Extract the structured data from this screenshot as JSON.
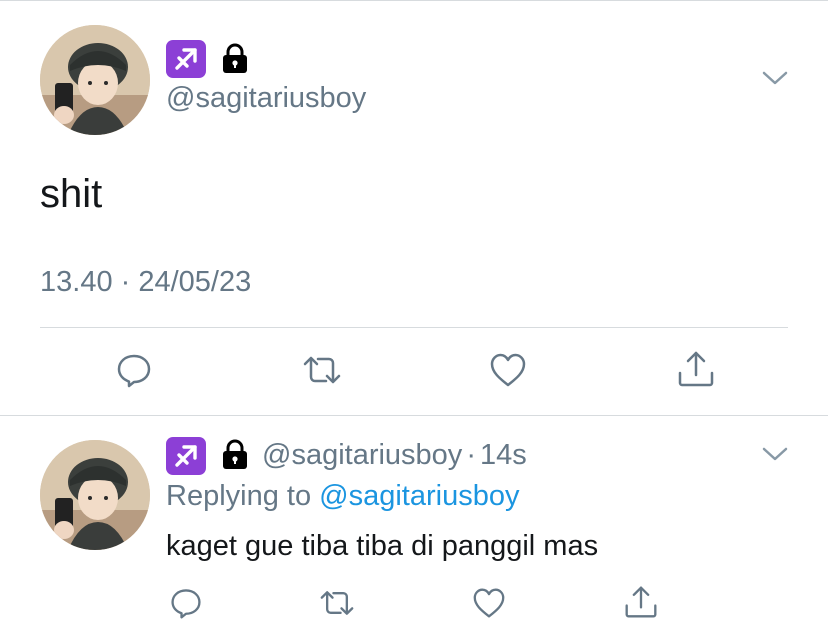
{
  "main_tweet": {
    "handle": "@sagitariusboy",
    "text": "shit",
    "timestamp": "13.40 · 24/05/23",
    "icons": [
      "sagittarius-icon",
      "lock-icon",
      "chevron-down-icon"
    ]
  },
  "actions": [
    "reply-icon",
    "retweet-icon",
    "like-icon",
    "share-icon"
  ],
  "reply_tweet": {
    "handle": "@sagitariusboy",
    "separator": "·",
    "time": "14s",
    "replying_prefix": "Replying to",
    "replying_to": "@sagitariusboy",
    "text": "kaget gue tiba tiba di panggil mas"
  },
  "colors": {
    "text": "#14171a",
    "secondary": "#657786",
    "link": "#1b95e0",
    "divider": "#d7dbde",
    "sagittarius_bg": "#8c3fd6"
  }
}
